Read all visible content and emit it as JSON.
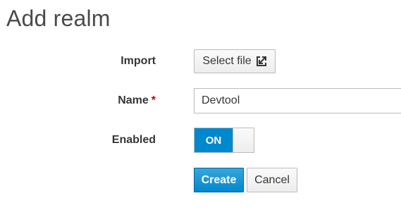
{
  "page": {
    "title": "Add realm"
  },
  "form": {
    "import_label": "Import",
    "select_file_label": "Select file",
    "name_label": "Name",
    "required_marker": "*",
    "name_value": "Devtool",
    "enabled_label": "Enabled",
    "enabled_state": "ON",
    "create_label": "Create",
    "cancel_label": "Cancel"
  },
  "colors": {
    "primary": "#0088ce",
    "required": "#cc0000"
  },
  "icons": {
    "select_file": "import-icon"
  }
}
